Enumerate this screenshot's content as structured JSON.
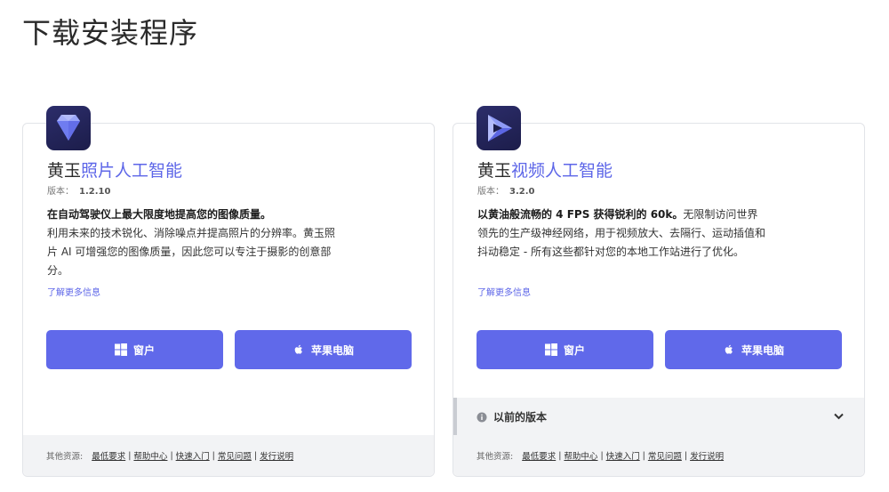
{
  "page": {
    "title": "下载安装程序"
  },
  "cards": [
    {
      "name_prefix": "黄玉",
      "name_accent": "照片人工智能",
      "version_label": "版本：",
      "version": "1.2.10",
      "desc_bold": "在自动驾驶仪上最大限度地提高您的图像质量。",
      "desc_rest": "利用未来的技术锐化、消除噪点并提高照片的分辨率。黄玉照片 AI 可增强您的图像质量，因此您可以专注于摄影的创意部分。",
      "learn_more": "了解更多信息",
      "btn_windows": "窗户",
      "btn_mac": "苹果电脑",
      "footer": {
        "label": "其他资源:",
        "links": [
          "最低要求",
          "帮助中心",
          "快速入门",
          "常见问题",
          "发行说明"
        ]
      }
    },
    {
      "name_prefix": "黄玉",
      "name_accent": "视频人工智能",
      "version_label": "版本：",
      "version": "3.2.0",
      "desc_bold": "以黄油般流畅的 4 FPS 获得锐利的 60k。",
      "desc_rest": "无限制访问世界领先的生产级神经网络，用于视频放大、去隔行、运动插值和抖动稳定 - 所有这些都针对您的本地工作站进行了优化。",
      "learn_more": "了解更多信息",
      "btn_windows": "窗户",
      "btn_mac": "苹果电脑",
      "prev_versions": "以前的版本",
      "footer": {
        "label": "其他资源:",
        "links": [
          "最低要求",
          "帮助中心",
          "快速入门",
          "常见问题",
          "发行说明"
        ]
      }
    }
  ],
  "colors": {
    "accent": "#5d66e8",
    "button": "#6069ea",
    "panel": "#f2f3f5"
  },
  "icons": {
    "windows": "windows-logo-icon",
    "apple": "apple-logo-icon",
    "info": "info-icon",
    "chevron": "chevron-down-icon"
  }
}
